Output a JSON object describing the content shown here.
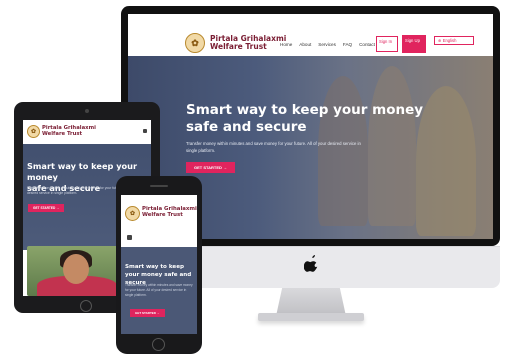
{
  "brand": {
    "name_line1": "Pirtala Grihalaxmi",
    "name_line2": "Welfare Trust",
    "logo_glyph": "✿",
    "color": "#7a1d33"
  },
  "nav": {
    "items": [
      "Home",
      "About",
      "Services",
      "FAQ",
      "Contact"
    ],
    "sign_in": "Sign In",
    "sign_up": "Sign Up",
    "language": "English"
  },
  "hero": {
    "title_line1": "Smart way to keep your money",
    "title_line2": "safe and secure",
    "subtitle": "Transfer money within minutes and save money for your future. All of your desired service in single platform.",
    "cta": "GET STARTED →"
  },
  "colors": {
    "accent": "#e0245e",
    "hero_bg": "#4b5876"
  }
}
